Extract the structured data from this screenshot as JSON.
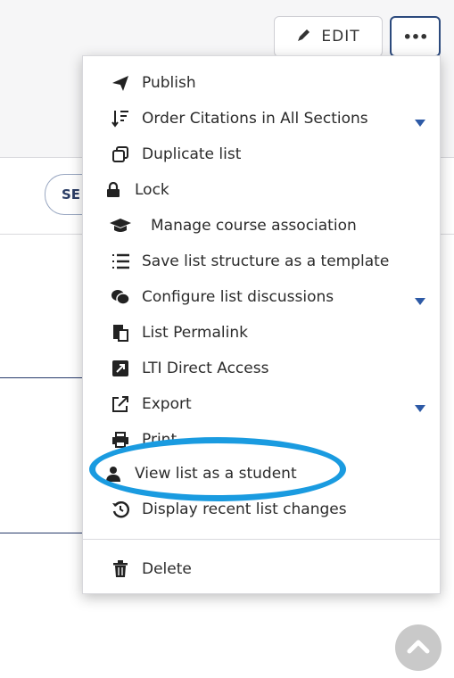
{
  "toolbar": {
    "edit_label": "EDIT",
    "pencil_icon": "pencil-icon",
    "more_label": "•••"
  },
  "background": {
    "partial_button_label": "SE"
  },
  "menu": {
    "items": [
      {
        "label": "Publish",
        "icon": "paper-plane-icon",
        "has_caret": false
      },
      {
        "label": "Order Citations in All Sections",
        "icon": "sort-icon",
        "has_caret": true
      },
      {
        "label": "Duplicate list",
        "icon": "duplicate-icon",
        "has_caret": false
      },
      {
        "label": "Lock",
        "icon": "lock-icon",
        "has_caret": false
      },
      {
        "label": "Manage course association",
        "icon": "graduation-cap-icon",
        "has_caret": false
      },
      {
        "label": "Save list structure as a template",
        "icon": "list-icon",
        "has_caret": false
      },
      {
        "label": "Configure list discussions",
        "icon": "comments-icon",
        "has_caret": true
      },
      {
        "label": "List Permalink",
        "icon": "permalink-icon",
        "has_caret": false
      },
      {
        "label": "LTI Direct Access",
        "icon": "external-square-icon",
        "has_caret": false
      },
      {
        "label": "Export",
        "icon": "export-icon",
        "has_caret": true
      },
      {
        "label": "Print",
        "icon": "print-icon",
        "has_caret": false
      },
      {
        "label": "View list as a student",
        "icon": "user-icon",
        "has_caret": false
      },
      {
        "label": "Display recent list changes",
        "icon": "history-icon",
        "has_caret": false
      },
      {
        "label": "Delete",
        "icon": "trash-icon",
        "has_caret": false
      }
    ]
  },
  "colors": {
    "accent": "#2c4a7d",
    "caret": "#2d5aa6",
    "highlight": "#1a9be0"
  }
}
